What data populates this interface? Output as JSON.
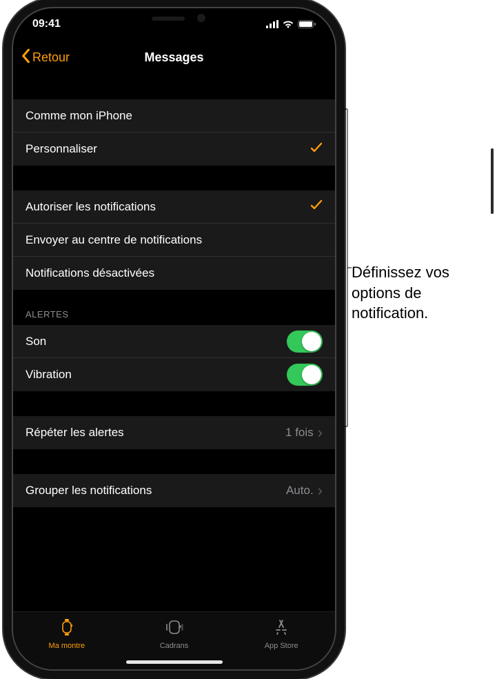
{
  "status": {
    "time": "09:41"
  },
  "nav": {
    "back": "Retour",
    "title": "Messages"
  },
  "mirror": {
    "items": [
      {
        "label": "Comme mon iPhone",
        "checked": false
      },
      {
        "label": "Personnaliser",
        "checked": true
      }
    ]
  },
  "notifications": {
    "items": [
      {
        "label": "Autoriser les notifications",
        "checked": true
      },
      {
        "label": "Envoyer au centre de notifications",
        "checked": false
      },
      {
        "label": "Notifications désactivées",
        "checked": false
      }
    ]
  },
  "alerts": {
    "header": "ALERTES",
    "items": [
      {
        "label": "Son",
        "on": true
      },
      {
        "label": "Vibration",
        "on": true
      }
    ]
  },
  "repeat": {
    "label": "Répéter les alertes",
    "value": "1 fois"
  },
  "grouping": {
    "label": "Grouper les notifications",
    "value": "Auto."
  },
  "tabs": {
    "items": [
      {
        "label": "Ma montre",
        "active": true
      },
      {
        "label": "Cadrans",
        "active": false
      },
      {
        "label": "App Store",
        "active": false
      }
    ]
  },
  "callout": "Définissez vos options de notification."
}
